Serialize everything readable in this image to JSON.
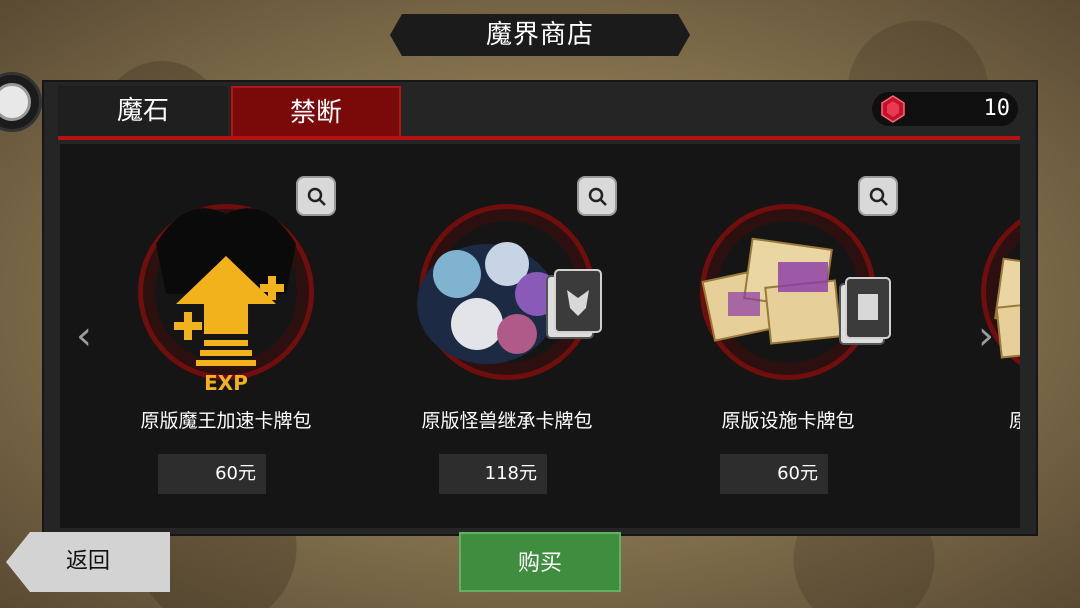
{
  "header": {
    "title": "魔界商店"
  },
  "tabs": [
    {
      "label": "魔石",
      "active": false
    },
    {
      "label": "禁断",
      "active": true
    }
  ],
  "currency": {
    "icon": "red-gem-icon",
    "count": "10"
  },
  "carousel": {
    "prev_icon": "chevron-left-icon",
    "next_icon": "chevron-right-icon",
    "items": [
      {
        "name": "原版魔王加速卡牌包",
        "price": "60元",
        "art": "exp-up-icon"
      },
      {
        "name": "原版怪兽继承卡牌包",
        "price": "118元",
        "art": "monster-group-icon"
      },
      {
        "name": "原版设施卡牌包",
        "price": "60元",
        "art": "scroll-pile-icon"
      },
      {
        "name": "原",
        "price": "",
        "art": "scroll-pile-icon"
      }
    ]
  },
  "footer": {
    "back_label": "返回",
    "buy_label": "购买"
  },
  "colors": {
    "accent_red": "#b51212",
    "buy_green": "#3f8d3f",
    "exp_yellow": "#f2b21c"
  }
}
